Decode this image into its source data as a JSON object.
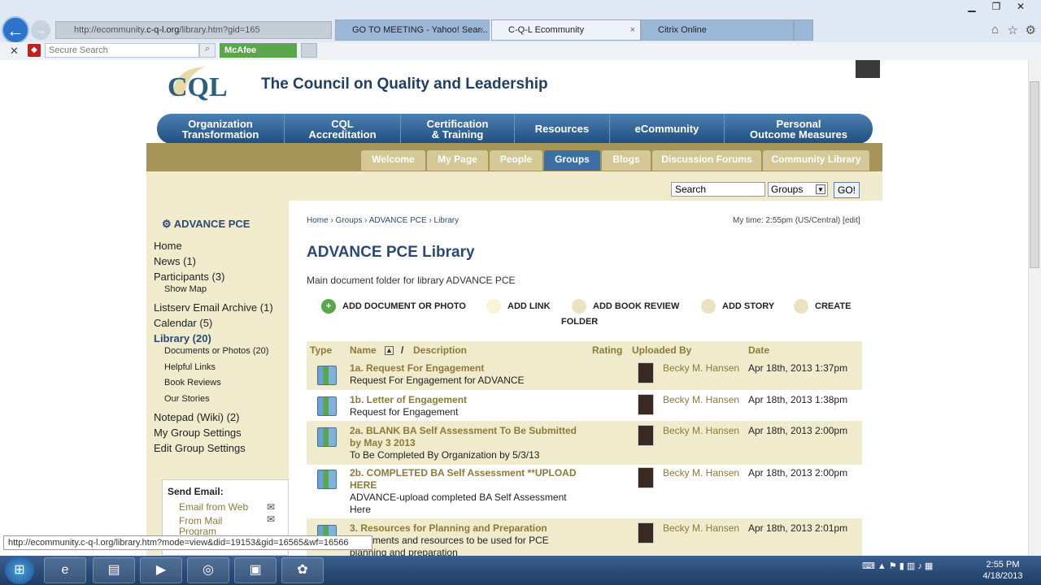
{
  "browser": {
    "address_prefix": "http://ecommunity.",
    "address_domain": "c-q-l.org",
    "address_suffix": "/library.htm?gid=165",
    "tabs": [
      {
        "label": "GO TO MEETING - Yahoo! Sear...",
        "close": "×"
      },
      {
        "label": "C-Q-L Ecommunity",
        "close": "×"
      },
      {
        "label": "Citrix Online"
      }
    ],
    "security_search_placeholder": "Secure Search",
    "mcafee_label": "McAfee"
  },
  "site": {
    "name": "The Council on Quality and Leadership",
    "logo_text": "CQL",
    "main_nav": [
      "Organization\nTransformation",
      "CQL\nAccreditation",
      "Certification\n& Training",
      "Resources",
      "eCommunity",
      "Personal\nOutcome Measures"
    ],
    "sub_nav": [
      "Welcome",
      "My Page",
      "People",
      "Groups",
      "Blogs",
      "Discussion Forums",
      "Community Library"
    ],
    "search_value": "Search",
    "search_scope": "Groups",
    "search_go": "GO!"
  },
  "sidebar": {
    "group_name": "ADVANCE PCE",
    "links": [
      {
        "label": "Home"
      },
      {
        "label": "News (1)"
      },
      {
        "label": "Participants (3)"
      },
      {
        "label": "Show Map",
        "sub": true
      },
      {
        "label": "Listserv Email Archive (1)"
      },
      {
        "label": "Calendar (5)"
      },
      {
        "label": "Library (20)",
        "active": true
      },
      {
        "label": "Documents or Photos (20)",
        "sub": true
      },
      {
        "label": "Helpful Links",
        "sub": true
      },
      {
        "label": "Book Reviews",
        "sub": true
      },
      {
        "label": "Our Stories",
        "sub": true
      },
      {
        "label": "Notepad (Wiki) (2)"
      },
      {
        "label": "My Group Settings"
      },
      {
        "label": "Edit Group Settings"
      }
    ],
    "send_email_title": "Send Email:",
    "send_links": [
      "Email from Web",
      "From Mail\nProgram"
    ]
  },
  "content": {
    "breadcrumb": "Home › Groups › ADVANCE PCE › Library",
    "my_time": "My time: 2:55pm (US/Central) [edit]",
    "title": "ADVANCE PCE Library",
    "description": "Main document folder for library ADVANCE PCE",
    "actions": [
      "ADD DOCUMENT OR PHOTO",
      "ADD LINK",
      "ADD BOOK REVIEW",
      "ADD STORY",
      "CREATE"
    ],
    "actions_wrap": "FOLDER",
    "columns": {
      "type": "Type",
      "name": "Name",
      "slash": "/",
      "description": "Description",
      "rating": "Rating",
      "uploaded_by": "Uploaded By",
      "date": "Date"
    },
    "rows": [
      {
        "name": "1a. Request For Engagement",
        "desc": "Request For Engagement for ADVANCE",
        "uploader": "Becky M. Hansen",
        "date": "Apr 18th, 2013 1:37pm"
      },
      {
        "name": "1b. Letter of Engagement",
        "desc": "Request for Engagement",
        "uploader": "Becky M. Hansen",
        "date": "Apr 18th, 2013 1:38pm"
      },
      {
        "name": "2a. BLANK BA Self Assessment To Be Submitted by May 3 2013",
        "desc": "To Be Completed By Organization by 5/3/13",
        "uploader": "Becky M. Hansen",
        "date": "Apr 18th, 2013 2:00pm"
      },
      {
        "name": "2b. COMPLETED BA Self Assessment **UPLOAD HERE",
        "desc": "ADVANCE-upload completed BA Self Assessment Here",
        "uploader": "Becky M. Hansen",
        "date": "Apr 18th, 2013 2:00pm"
      },
      {
        "name": "3. Resources for Planning and Preparation",
        "desc": "Documents and resources to be used for PCE planning and preparation",
        "uploader": "Becky M. Hansen",
        "date": "Apr 18th, 2013 2:01pm"
      }
    ]
  },
  "status_url": "http://ecommunity.c-q-l.org/library.htm?mode=view&did=19153&gid=16565&wf=16566",
  "taskbar": {
    "time": "2:55 PM",
    "date": "4/18/2013"
  }
}
